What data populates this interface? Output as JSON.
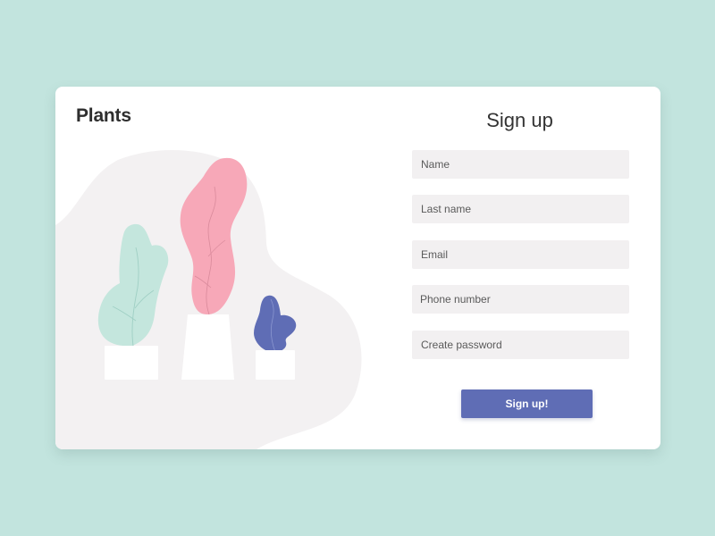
{
  "brand": {
    "title": "Plants"
  },
  "signup": {
    "title": "Sign up",
    "fields": {
      "name_placeholder": "Name",
      "last_name_placeholder": "Last name",
      "email_placeholder": "Email",
      "phone_placeholder": "Phone number",
      "password_placeholder": "Create password"
    },
    "submit_label": "Sign up!"
  },
  "colors": {
    "background": "#c2e4de",
    "card": "#ffffff",
    "input_fill": "#f2f0f1",
    "button": "#5f6db5",
    "leaf_mint": "#c4e6dd",
    "leaf_pink": "#f7a8b8",
    "leaf_blue": "#5f6db5",
    "blob": "#f3f1f2"
  }
}
